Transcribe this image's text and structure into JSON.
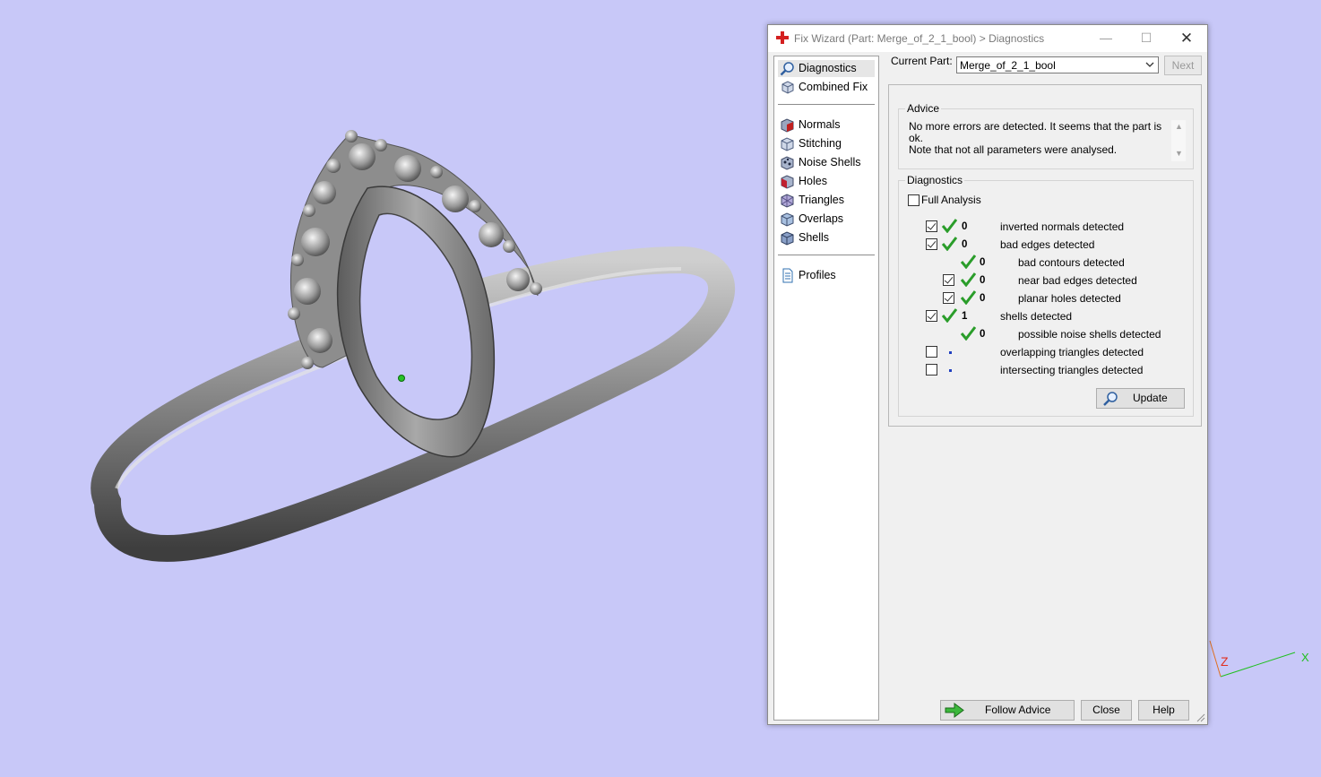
{
  "window": {
    "title": "Fix Wizard (Part: Merge_of_2_1_bool) > Diagnostics",
    "minimize_glyph": "—",
    "maximize_glyph": "☐",
    "close_glyph": "✕"
  },
  "nav": {
    "items": [
      {
        "label": "Diagnostics",
        "icon": "magnifier-icon"
      },
      {
        "label": "Combined Fix",
        "icon": "cube-icon"
      },
      {
        "label": "Normals",
        "icon": "normals-icon"
      },
      {
        "label": "Stitching",
        "icon": "stitching-icon"
      },
      {
        "label": "Noise Shells",
        "icon": "noise-shells-icon"
      },
      {
        "label": "Holes",
        "icon": "holes-icon"
      },
      {
        "label": "Triangles",
        "icon": "triangles-icon"
      },
      {
        "label": "Overlaps",
        "icon": "overlaps-icon"
      },
      {
        "label": "Shells",
        "icon": "shells-icon"
      },
      {
        "label": "Profiles",
        "icon": "profiles-icon"
      }
    ]
  },
  "current_part": {
    "label": "Current Part:",
    "value": "Merge_of_2_1_bool",
    "next_label": "Next"
  },
  "advice": {
    "title": "Advice",
    "line1": "No more errors are detected. It seems that the part is ok.",
    "line2": "Note that not all parameters were analysed."
  },
  "diagnostics": {
    "title": "Diagnostics",
    "full_analysis_label": "Full Analysis",
    "full_analysis_checked": false,
    "rows": [
      {
        "label": "inverted normals detected",
        "count": "0",
        "checked": true
      },
      {
        "label": "bad edges detected",
        "count": "0",
        "checked": true
      },
      {
        "label": "bad contours detected",
        "count": "0",
        "checked": null
      },
      {
        "label": "near bad edges detected",
        "count": "0",
        "checked": true
      },
      {
        "label": "planar holes detected",
        "count": "0",
        "checked": true
      },
      {
        "label": "shells detected",
        "count": "1",
        "checked": true
      },
      {
        "label": "possible noise shells detected",
        "count": "0",
        "checked": null
      },
      {
        "label": "overlapping triangles detected",
        "count": "",
        "checked": false
      },
      {
        "label": "intersecting triangles detected",
        "count": "",
        "checked": false
      }
    ],
    "update_label": "Update"
  },
  "footer": {
    "follow_advice_label": "Follow Advice",
    "close_label": "Close",
    "help_label": "Help"
  },
  "axes": {
    "z_label": "Z",
    "x_label": "X"
  },
  "colors": {
    "viewport_bg": "#c8c8f8",
    "check_green": "#2a9d2a",
    "title_icon_red": "#d42020"
  }
}
